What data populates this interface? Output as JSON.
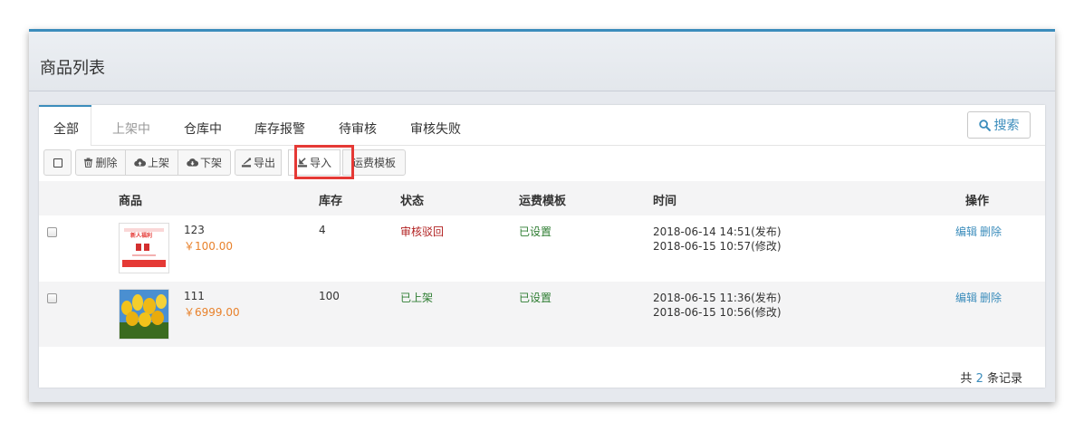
{
  "page": {
    "title": "商品列表"
  },
  "tabs": [
    {
      "label": "全部",
      "state": "active"
    },
    {
      "label": "上架中",
      "state": "disabled"
    },
    {
      "label": "仓库中",
      "state": "normal"
    },
    {
      "label": "库存报警",
      "state": "normal"
    },
    {
      "label": "待审核",
      "state": "normal"
    },
    {
      "label": "审核失败",
      "state": "normal"
    }
  ],
  "search_button": {
    "label": "搜索",
    "icon": "search-icon"
  },
  "toolbar": {
    "select_all_icon": "checkbox-icon",
    "delete": {
      "label": "删除",
      "icon": "trash-icon"
    },
    "on_shelf": {
      "label": "上架",
      "icon": "cloud-upload-icon"
    },
    "off_shelf": {
      "label": "下架",
      "icon": "cloud-download-icon"
    },
    "export": {
      "label": "导出",
      "icon": "export-icon"
    },
    "import": {
      "label": "导入",
      "icon": "import-icon"
    },
    "shipping_template": {
      "label": "运费模板"
    }
  },
  "table": {
    "columns": {
      "product": "商品",
      "stock": "库存",
      "status": "状态",
      "shipping": "运费模板",
      "time": "时间",
      "actions": "操作"
    },
    "rows": [
      {
        "name": "123",
        "price": "￥100.00",
        "stock": "4",
        "status": "审核驳回",
        "status_color": "#b22222",
        "shipping": "已设置",
        "published": "2018-06-14 14:51(发布)",
        "modified": "2018-06-15 10:57(修改)",
        "edit": "编辑",
        "delete": "删除",
        "thumb_text": "新人福利"
      },
      {
        "name": "111",
        "price": "￥6999.00",
        "stock": "100",
        "status": "已上架",
        "status_color": "#2e7d32",
        "shipping": "已设置",
        "published": "2018-06-15 11:36(发布)",
        "modified": "2018-06-15 10:56(修改)",
        "edit": "编辑",
        "delete": "删除"
      }
    ]
  },
  "footer": {
    "prefix": "共",
    "count": "2",
    "suffix": "条记录"
  },
  "colors": {
    "accent": "#3c8dbc",
    "highlight": "#e53935",
    "price": "#e8822c"
  }
}
